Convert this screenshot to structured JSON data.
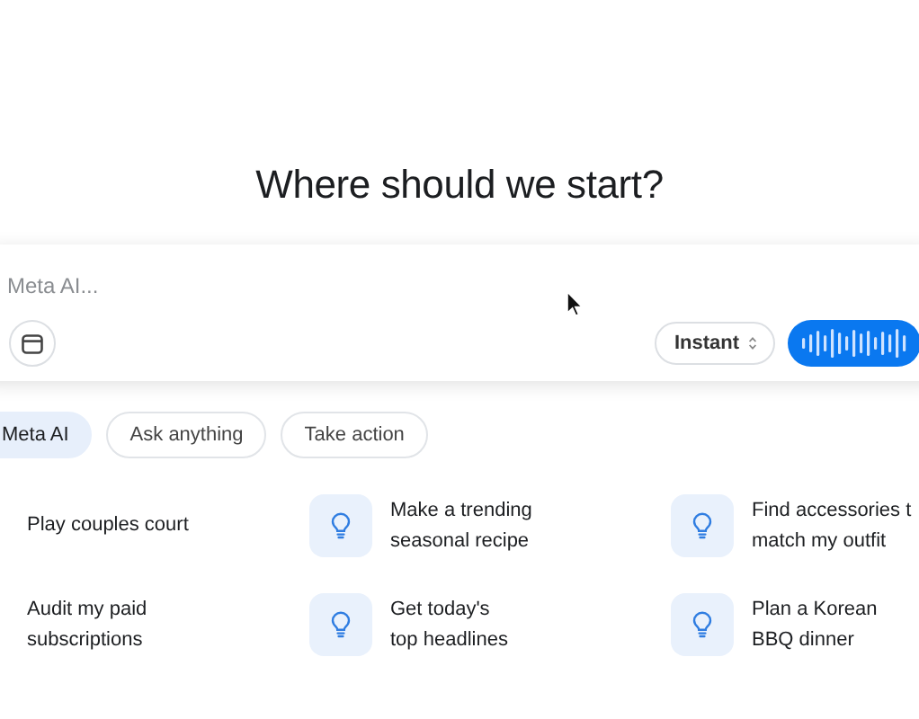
{
  "heading": "Where should we start?",
  "composer": {
    "placeholder": "Meta AI...",
    "mode": "Instant"
  },
  "tabs": [
    {
      "label": "Meta AI",
      "selected": true
    },
    {
      "label": "Ask anything",
      "selected": false
    },
    {
      "label": "Take action",
      "selected": false
    }
  ],
  "suggestions": [
    {
      "kind": "text-only",
      "lines": [
        "Play couples court"
      ]
    },
    {
      "kind": "with-icon",
      "lines": [
        "Make a trending",
        "seasonal recipe"
      ]
    },
    {
      "kind": "with-icon",
      "lines": [
        "Find accessories t",
        "match my outfit"
      ]
    },
    {
      "kind": "text-only",
      "lines": [
        "Audit my paid",
        "subscriptions"
      ]
    },
    {
      "kind": "with-icon",
      "lines": [
        "Get today's",
        "top headlines"
      ]
    },
    {
      "kind": "with-icon",
      "lines": [
        "Plan a Korean",
        "BBQ dinner"
      ]
    }
  ]
}
